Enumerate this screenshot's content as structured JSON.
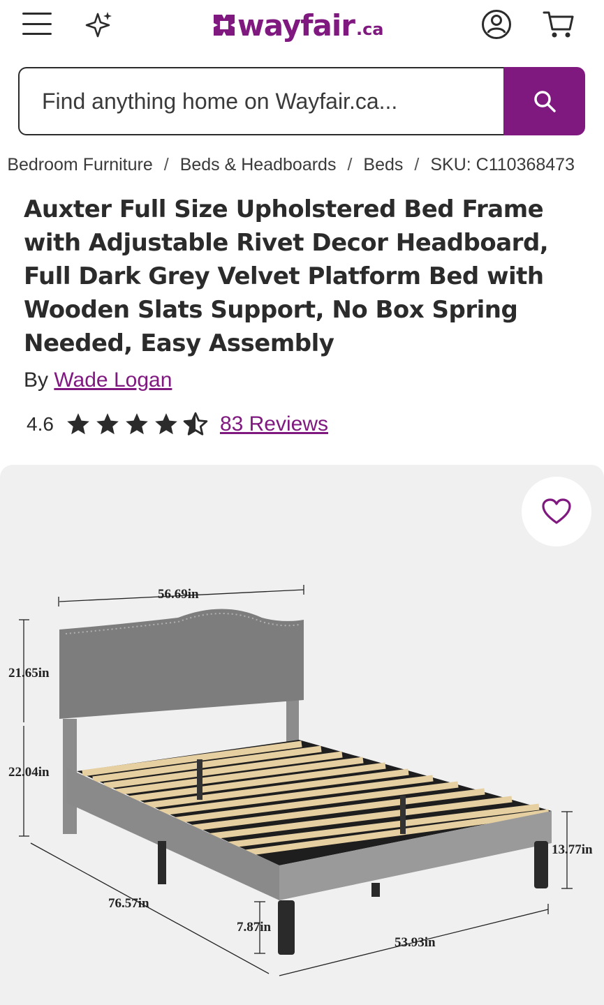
{
  "header": {
    "logo_text": "wayfair",
    "logo_tld": ".ca",
    "icons": [
      "menu-icon",
      "sparkle-icon",
      "account-icon",
      "cart-icon"
    ]
  },
  "search": {
    "placeholder": "Find anything home on Wayfair.ca..."
  },
  "breadcrumb": {
    "items": [
      "Bedroom Furniture",
      "Beds & Headboards",
      "Beds"
    ],
    "separator": "/",
    "sku": "SKU: C110368473"
  },
  "product": {
    "title": "Auxter Full Size Upholstered Bed Frame with Adjustable Rivet Decor Headboard, Full Dark Grey Velvet Platform Bed with Wooden Slats Support, No Box Spring Needed, Easy Assembly",
    "by_label": "By",
    "brand": "Wade Logan",
    "rating": "4.6",
    "rating_value": 4.6,
    "rating_max": 5,
    "reviews": "83 Reviews"
  },
  "image": {
    "dimensions": {
      "width": "56.69in",
      "headboard_height": "21.65in",
      "leg_to_headboard": "22.04in",
      "length": "76.57in",
      "leg_height": "7.87in",
      "frame_height": "13.77in",
      "outer_width": "53.93in"
    }
  },
  "colors": {
    "brand": "#7f187f",
    "text": "#2b2b2b",
    "gallery_bg": "#f0f0f0"
  }
}
